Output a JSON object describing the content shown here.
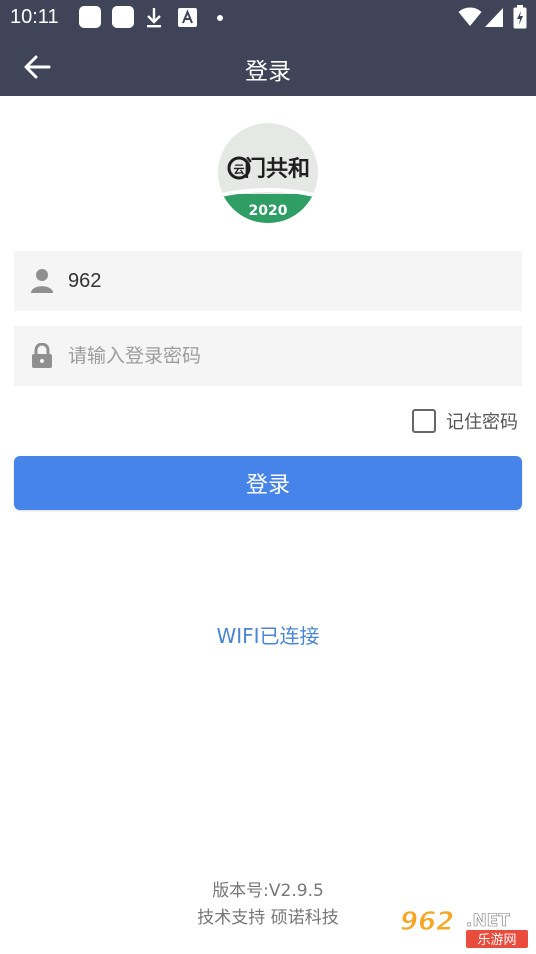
{
  "status_bar": {
    "time": "10:11",
    "notification_icons": [
      "app-square-icon",
      "app-square-icon",
      "download-icon",
      "font-a-icon",
      "dot-icon"
    ],
    "system_icons": [
      "wifi-icon",
      "signal-icon",
      "battery-charging-icon"
    ]
  },
  "app_bar": {
    "title": "登录",
    "back_icon": "arrow-left-icon"
  },
  "logo": {
    "text": "门共和",
    "year": "2020",
    "colors": {
      "ring": "#e8e8e8",
      "green": "#2e9e64",
      "dark": "#1f1f1f"
    }
  },
  "form": {
    "username": {
      "value": "962",
      "icon": "user-icon"
    },
    "password": {
      "value": "",
      "placeholder": "请输入登录密码",
      "icon": "lock-icon"
    },
    "remember": {
      "label": "记住密码",
      "checked": false
    },
    "login_button": "登录"
  },
  "wifi_status": "WIFI已连接",
  "footer": {
    "version": "版本号:V2.9.5",
    "support": "技术支持  硕诺科技"
  },
  "watermark": {
    "number": "962",
    "domain": ".NET",
    "caption": "乐游网"
  },
  "colors": {
    "header_bg": "#3f4458",
    "primary": "#4784ea",
    "link": "#4a86d4",
    "field_bg": "#f5f5f5"
  }
}
